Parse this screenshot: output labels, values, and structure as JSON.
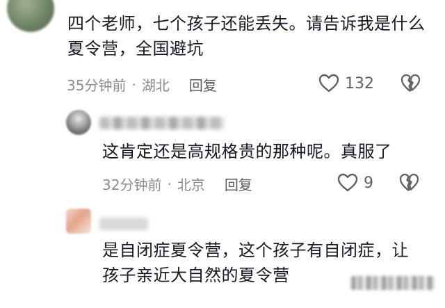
{
  "comments": [
    {
      "text": "四个老师，七个孩子还能丢失。请告诉我是什么夏令营，全国避坑",
      "time": "35分钟前",
      "location": "湖北",
      "reply_label": "回复",
      "likes": "132",
      "separator": "·"
    },
    {
      "text": "这肯定还是高规格贵的那种呢。真服了",
      "time": "32分钟前",
      "location": "北京",
      "reply_label": "回复",
      "likes": "9",
      "separator": "·"
    },
    {
      "text": "是自闭症夏令营，这个孩子有自闭症，让孩子亲近大自然的夏令营"
    }
  ],
  "icons": {
    "like": "heart-outline-icon",
    "dislike": "broken-heart-icon"
  },
  "colors": {
    "text": "#161823",
    "meta": "#8a8b91",
    "icon": "#5f6066"
  }
}
